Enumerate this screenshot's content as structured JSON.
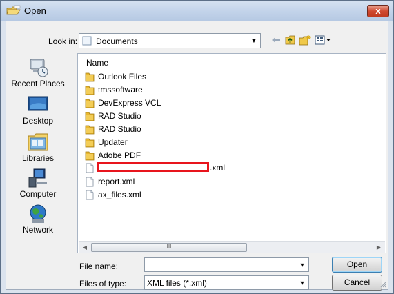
{
  "window": {
    "title": "Open",
    "close_label": "x"
  },
  "lookin": {
    "label": "Look in:",
    "value": "Documents"
  },
  "toolbar": {
    "icons": [
      "back-arrow-icon",
      "up-folder-icon",
      "new-folder-icon",
      "view-menu-icon"
    ]
  },
  "places": [
    {
      "label": "Recent Places",
      "icon": "recent-places-icon"
    },
    {
      "label": "Desktop",
      "icon": "desktop-icon"
    },
    {
      "label": "Libraries",
      "icon": "libraries-icon"
    },
    {
      "label": "Computer",
      "icon": "computer-icon"
    },
    {
      "label": "Network",
      "icon": "network-icon"
    }
  ],
  "filelist": {
    "column_header": "Name",
    "items": [
      {
        "name": "Outlook Files",
        "type": "folder"
      },
      {
        "name": "tmssoftware",
        "type": "folder"
      },
      {
        "name": "DevExpress VCL",
        "type": "folder"
      },
      {
        "name": "RAD Studio",
        "type": "folder"
      },
      {
        "name": "RAD Studio",
        "type": "folder"
      },
      {
        "name": "Updater",
        "type": "folder"
      },
      {
        "name": "Adobe PDF",
        "type": "folder"
      },
      {
        "name": ".xml",
        "type": "file"
      },
      {
        "name": "report.xml",
        "type": "file"
      },
      {
        "name": "ax_files.xml",
        "type": "file"
      }
    ],
    "scroll_thumb_grip": "III"
  },
  "filename": {
    "label": "File name:",
    "value": ""
  },
  "filetype": {
    "label": "Files of type:",
    "value": "XML files (*.xml)"
  },
  "buttons": {
    "open": "Open",
    "cancel": "Cancel"
  },
  "colors": {
    "folder": "#e8b730",
    "redaction": "#e8151d",
    "title_bar": "#c2d3ea",
    "close_button": "#d04a31"
  }
}
